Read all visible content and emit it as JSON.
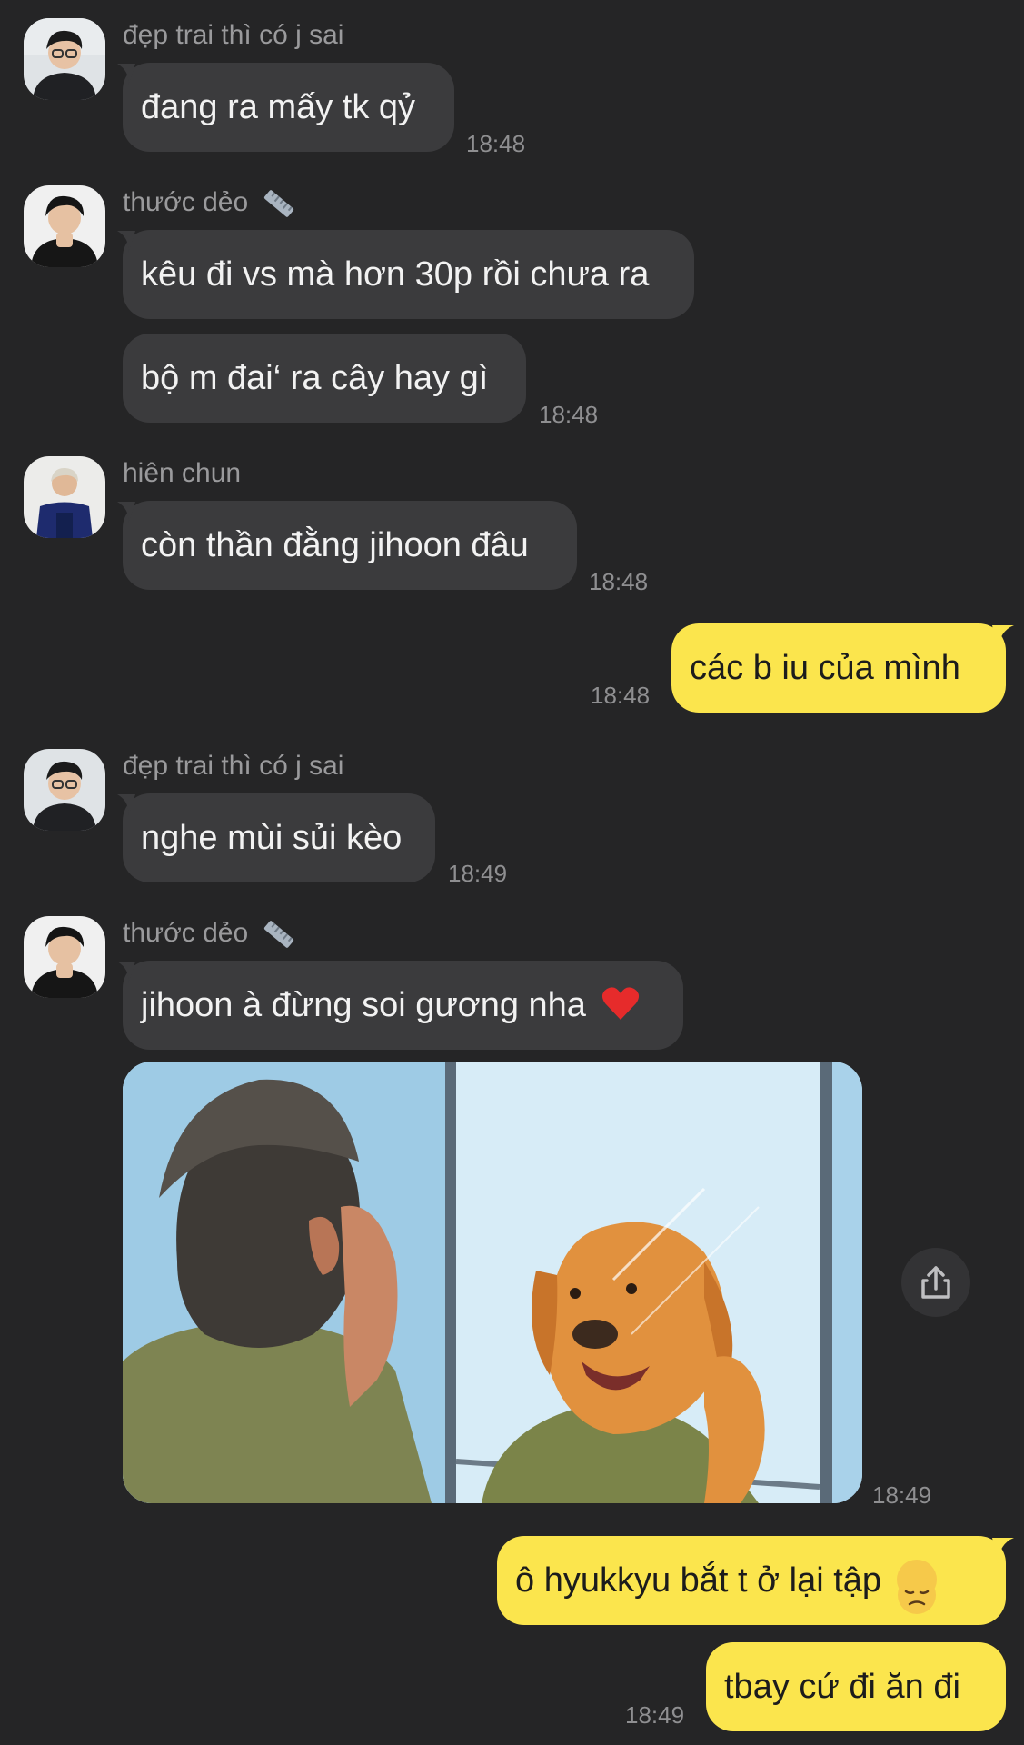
{
  "messages": [
    {
      "sender": "đẹp trai thì có j sai",
      "text": "đang ra mấy tk qỷ",
      "time": "18:48"
    },
    {
      "sender": "thước dẻo",
      "text1": "kêu đi vs mà hơn 30p rồi chưa ra",
      "text2": "bộ m đai‘ ra cây hay gì",
      "time": "18:48"
    },
    {
      "sender": "hiên chun",
      "text": "còn thần đằng jihoon đâu",
      "time": "18:48"
    },
    {
      "text": "các b iu của mình",
      "time": "18:48"
    },
    {
      "sender": "đẹp trai thì có j sai",
      "text": "nghe mùi sủi kèo",
      "time": "18:49"
    },
    {
      "sender": "thước dẻo",
      "text": "jihoon à đừng soi gương nha",
      "time": "18:49",
      "image_time": "18:49"
    },
    {
      "text1": "ô hyukkyu bắt t  ở lại tập",
      "text2": "tbay cứ đi ăn đi",
      "time": "18:49"
    }
  ],
  "icons": {
    "ruler": "ruler-icon",
    "heart": "red-heart-emoji",
    "sad": "disappointed-face-emoji",
    "share": "share-icon"
  },
  "colors": {
    "background": "#252526",
    "incoming_bubble": "#3b3b3d",
    "outgoing_bubble": "#fbe54d"
  }
}
